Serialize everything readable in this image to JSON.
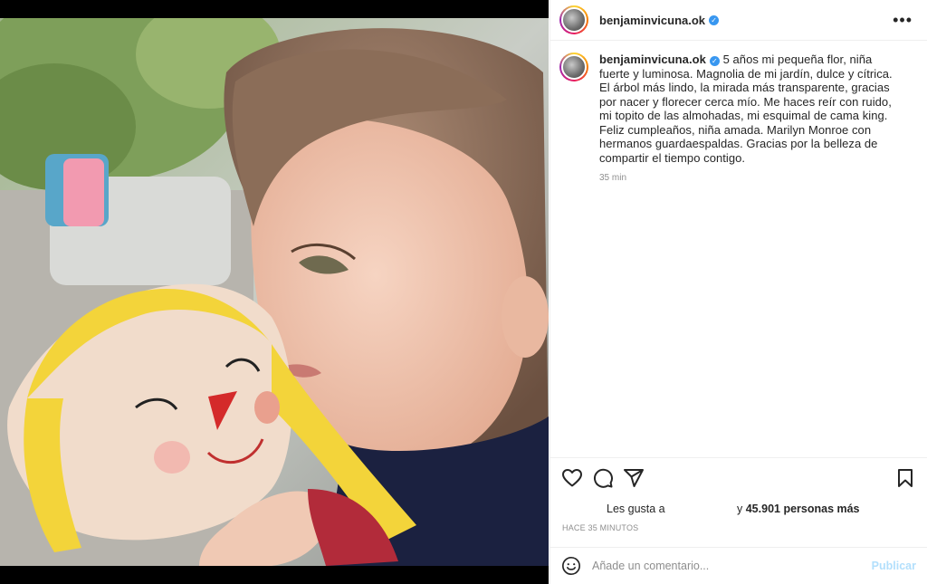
{
  "post": {
    "username": "benjaminvicuna.ok",
    "verified": true,
    "caption": "5 años mi pequeña flor, niña fuerte y luminosa. Magnolia de mi jardín, dulce y cítrica. El árbol más lindo, la mirada más transparente, gracias por nacer y florecer cerca mío. Me haces reír con ruido, mi topito de las almohadas, mi esquimal de cama king. Feliz cumpleaños, niña amada. Marilyn Monroe con hermanos guardaespaldas. Gracias por la belleza de compartir el tiempo contigo.",
    "caption_time": "35 min"
  },
  "icons": {
    "more": "more-options-icon",
    "like": "heart-icon",
    "comment": "comment-icon",
    "share": "send-icon",
    "save": "bookmark-icon",
    "emoji": "emoji-icon"
  },
  "likes": {
    "prefix": "Les gusta a",
    "suffix_pre": "y ",
    "count_text": "45.901 personas más"
  },
  "timestamp": "HACE 35 MINUTOS",
  "comment": {
    "placeholder": "Añade un comentario...",
    "publish_label": "Publicar"
  },
  "colors": {
    "verified": "#3897f0",
    "publish_disabled": "#b2dffc",
    "muted_text": "#8e8e8e"
  }
}
